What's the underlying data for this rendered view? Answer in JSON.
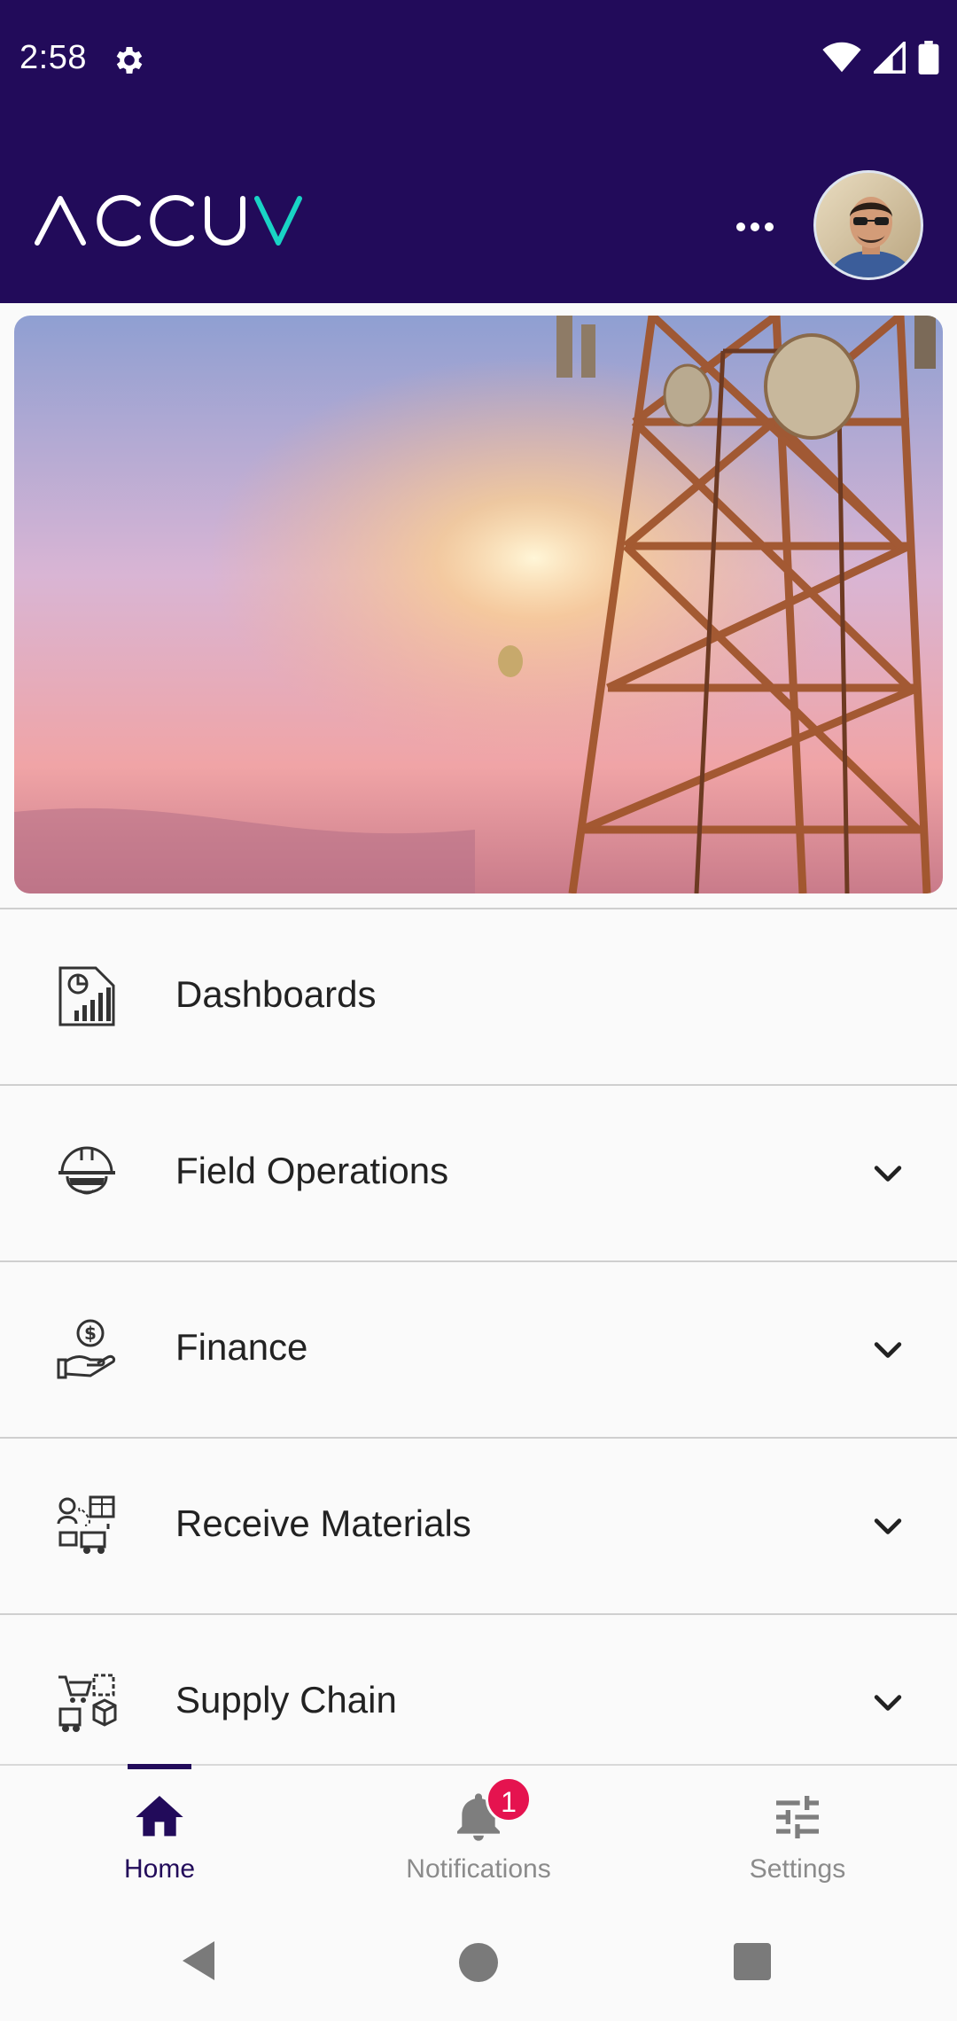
{
  "status_bar": {
    "time": "2:58",
    "icons": [
      "gear-icon",
      "wifi-icon",
      "signal-icon",
      "battery-icon"
    ]
  },
  "app_bar": {
    "logo_text": "ACCUV",
    "more_icon": "more-horizontal-icon",
    "avatar": "user-avatar"
  },
  "banner": {
    "subject": "telecom-tower-sunset"
  },
  "menu": {
    "items": [
      {
        "label": "Dashboards",
        "icon": "dashboard-report-icon",
        "expandable": false
      },
      {
        "label": "Field Operations",
        "icon": "hard-hat-worker-icon",
        "expandable": true
      },
      {
        "label": "Finance",
        "icon": "hand-money-icon",
        "expandable": true
      },
      {
        "label": "Receive Materials",
        "icon": "receive-materials-icon",
        "expandable": true
      },
      {
        "label": "Supply Chain",
        "icon": "supply-chain-icon",
        "expandable": true
      }
    ]
  },
  "bottom_nav": {
    "items": [
      {
        "label": "Home",
        "icon": "home-icon",
        "active": true
      },
      {
        "label": "Notifications",
        "icon": "bell-icon",
        "badge": "1"
      },
      {
        "label": "Settings",
        "icon": "sliders-icon"
      }
    ]
  },
  "colors": {
    "primary": "#220b5a",
    "accent": "#19d3c5",
    "badge": "#e5134f"
  }
}
